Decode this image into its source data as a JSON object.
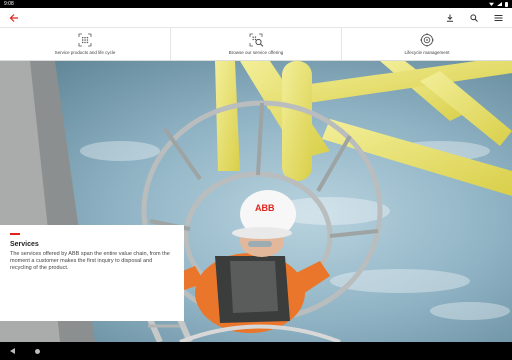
{
  "status": {
    "time": "9:08"
  },
  "appbar": {
    "back_icon": "back-arrow-icon",
    "accent_color": "#e2231a",
    "actions": [
      "download-icon",
      "search-icon",
      "menu-icon"
    ]
  },
  "tabs": [
    {
      "label": "Service products and life cycle",
      "icon": "grid-scan-icon"
    },
    {
      "label": "Browse our service offering",
      "icon": "search-grid-icon"
    },
    {
      "label": "Lifecycle management",
      "icon": "target-icon"
    }
  ],
  "hero": {
    "card_title": "Services",
    "card_text": "The services offered by ABB span the entire value chain, from the moment a customer makes the first inquiry to disposal and recycling of the product.",
    "helmet_logo": "ABB"
  }
}
